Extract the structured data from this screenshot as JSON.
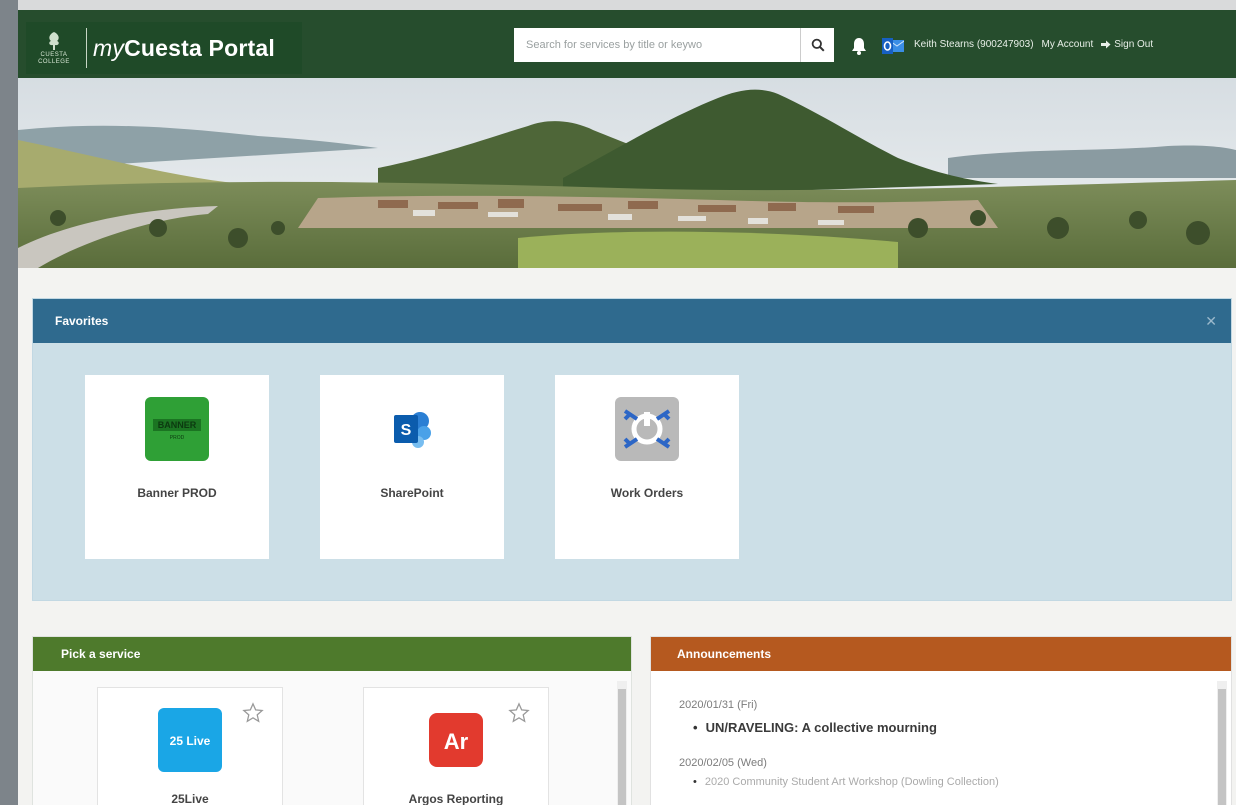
{
  "header": {
    "college_logo_text": "CUESTA COLLEGE",
    "portal_prefix": "my",
    "portal_name": "Cuesta Portal",
    "search_placeholder": "Search for services by title or keywo",
    "user_label": "Keith Stearns (900247903)",
    "my_account": "My Account",
    "sign_out": "Sign Out",
    "colors": {
      "header_bg": "#264d2d",
      "brand_bg": "#1f4a28"
    }
  },
  "favorites": {
    "title": "Favorites",
    "tiles": [
      {
        "label": "Banner PROD",
        "icon": "banner-prod-icon",
        "icon_text": "BANNER",
        "icon_subtext": "PROD"
      },
      {
        "label": "SharePoint",
        "icon": "sharepoint-icon",
        "icon_text": "S"
      },
      {
        "label": "Work Orders",
        "icon": "work-orders-icon"
      }
    ],
    "colors": {
      "header": "#2f6a8e",
      "panel": "#ccdfe7"
    }
  },
  "services": {
    "title": "Pick a service",
    "tiles": [
      {
        "label": "25Live",
        "icon": "25live-icon",
        "icon_text": "25 Live"
      },
      {
        "label": "Argos Reporting",
        "icon": "argos-icon",
        "icon_text": "Ar"
      }
    ],
    "colors": {
      "header": "#4e7a2c"
    }
  },
  "announcements": {
    "title": "Announcements",
    "items": [
      {
        "date": "2020/01/31 (Fri)",
        "text": "UN/RAVELING: A collective mourning"
      },
      {
        "date": "2020/02/05 (Wed)",
        "text": "2020 Community Student Art Workshop (Dowling Collection)"
      }
    ],
    "colors": {
      "header": "#b5591f"
    }
  }
}
